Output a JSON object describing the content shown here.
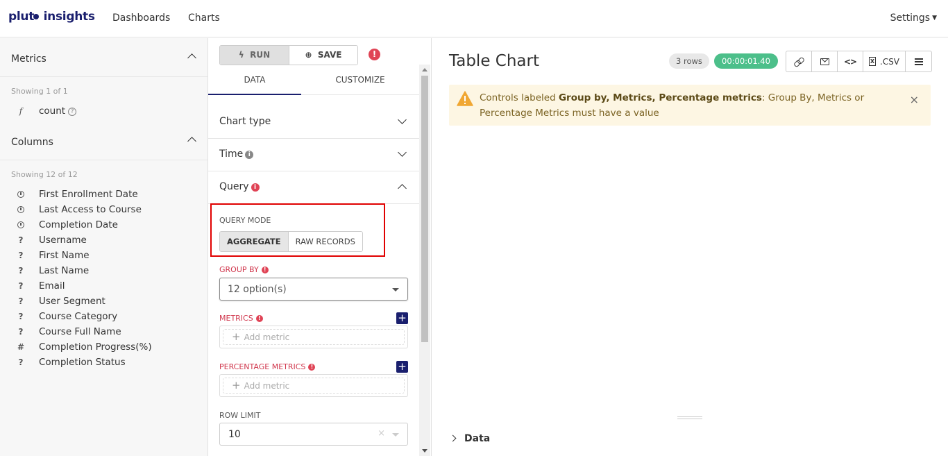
{
  "nav": {
    "logo_part1": "plut",
    "logo_part2": " insights",
    "links": [
      "Dashboards",
      "Charts"
    ],
    "settings": "Settings"
  },
  "left": {
    "metrics_header": "Metrics",
    "metrics_showing": "Showing 1 of 1",
    "metrics": [
      {
        "icon": "f",
        "label": "count"
      }
    ],
    "columns_header": "Columns",
    "columns_showing": "Showing 12 of 12",
    "columns": [
      {
        "type": "clock",
        "label": "First Enrollment Date"
      },
      {
        "type": "clock",
        "label": "Last Access to Course"
      },
      {
        "type": "clock",
        "label": "Completion Date"
      },
      {
        "type": "?",
        "label": "Username"
      },
      {
        "type": "?",
        "label": "First Name"
      },
      {
        "type": "?",
        "label": "Last Name"
      },
      {
        "type": "?",
        "label": "Email"
      },
      {
        "type": "?",
        "label": "User Segment"
      },
      {
        "type": "?",
        "label": "Course Category"
      },
      {
        "type": "?",
        "label": "Course Full Name"
      },
      {
        "type": "#",
        "label": "Completion Progress(%)"
      },
      {
        "type": "?",
        "label": "Completion Status"
      }
    ]
  },
  "middle": {
    "run_label": "RUN",
    "save_label": "SAVE",
    "tabs": [
      "DATA",
      "CUSTOMIZE"
    ],
    "sections": [
      "Chart type",
      "Time",
      "Query"
    ],
    "query_mode_label": "QUERY MODE",
    "query_modes": [
      "AGGREGATE",
      "RAW RECORDS"
    ],
    "group_by_label": "GROUP BY",
    "group_by_value": "12 option(s)",
    "metrics_label": "METRICS",
    "add_metric": "Add metric",
    "pct_metrics_label": "PERCENTAGE METRICS",
    "row_limit_label": "ROW LIMIT",
    "row_limit_value": "10"
  },
  "right": {
    "title": "Table Chart",
    "rows_badge": "3 rows",
    "time_badge": "00:00:01.40",
    "csv_label": ".CSV",
    "alert_prefix": "Controls labeled ",
    "alert_bold": "Group by, Metrics, Percentage metrics",
    "alert_suffix": ": Group By, Metrics or Percentage Metrics must have a value",
    "data_toggle": "Data"
  },
  "colors": {
    "brand": "#1a1f6e",
    "error": "#e04355",
    "success": "#4cbf8a",
    "warning_bg": "#fdf6e3",
    "highlight": "#e00000"
  }
}
